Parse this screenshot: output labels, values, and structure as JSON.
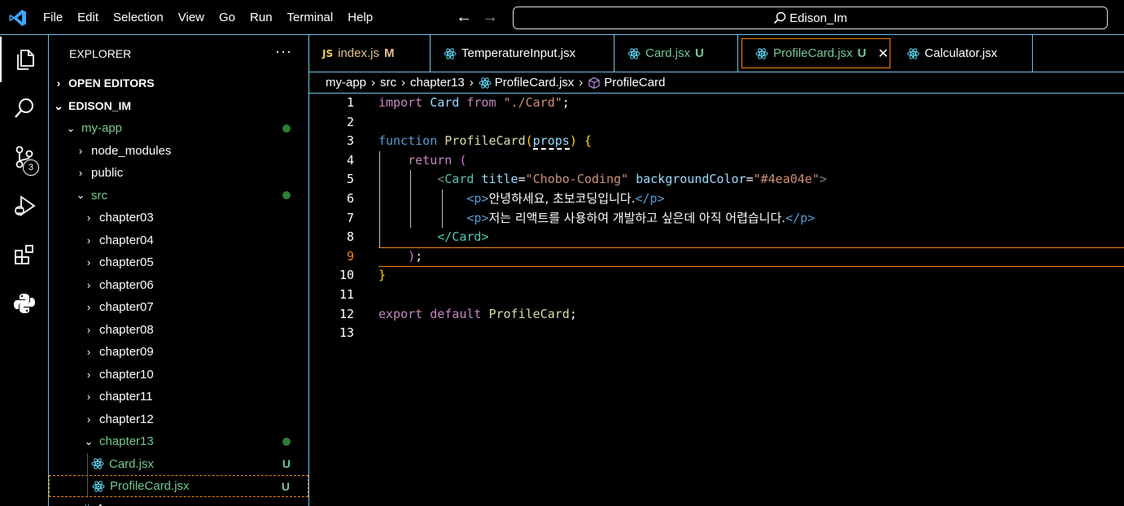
{
  "menu": [
    "File",
    "Edit",
    "Selection",
    "View",
    "Go",
    "Run",
    "Terminal",
    "Help"
  ],
  "search": {
    "text": "Edison_Im"
  },
  "activity": {
    "scm_badge": "3"
  },
  "sidebar": {
    "title": "EXPLORER",
    "more": "···",
    "open_editors": "OPEN EDITORS",
    "workspace": "EDISON_IM",
    "tree": [
      {
        "label": "my-app",
        "chevron": "⌄",
        "depth": 0,
        "green": true,
        "dot": true
      },
      {
        "label": "node_modules",
        "chevron": "›",
        "depth": 1
      },
      {
        "label": "public",
        "chevron": "›",
        "depth": 1
      },
      {
        "label": "src",
        "chevron": "⌄",
        "depth": 1,
        "green": true,
        "dot": true
      },
      {
        "label": "chapter03",
        "chevron": "›",
        "depth": 2
      },
      {
        "label": "chapter04",
        "chevron": "›",
        "depth": 2
      },
      {
        "label": "chapter05",
        "chevron": "›",
        "depth": 2
      },
      {
        "label": "chapter06",
        "chevron": "›",
        "depth": 2
      },
      {
        "label": "chapter07",
        "chevron": "›",
        "depth": 2
      },
      {
        "label": "chapter08",
        "chevron": "›",
        "depth": 2
      },
      {
        "label": "chapter09",
        "chevron": "›",
        "depth": 2
      },
      {
        "label": "chapter10",
        "chevron": "›",
        "depth": 2
      },
      {
        "label": "chapter11",
        "chevron": "›",
        "depth": 2
      },
      {
        "label": "chapter12",
        "chevron": "›",
        "depth": 2
      },
      {
        "label": "chapter13",
        "chevron": "⌄",
        "depth": 2,
        "green": true,
        "dot": true
      },
      {
        "label": "Card.jsx",
        "depth": 3,
        "green": true,
        "u": "U",
        "react": true
      },
      {
        "label": "ProfileCard.jsx",
        "depth": 3,
        "green": true,
        "u": "U",
        "react": true,
        "selected": true
      },
      {
        "label": "App.css",
        "depth": 2,
        "hash": true
      }
    ]
  },
  "tabs": [
    {
      "label": "index.js",
      "icon": "JS",
      "status": "M"
    },
    {
      "label": "TemperatureInput.jsx"
    },
    {
      "label": "Card.jsx",
      "status": "U",
      "green": true
    },
    {
      "label": "ProfileCard.jsx",
      "status": "U",
      "green": true,
      "active": true,
      "close": "✕"
    },
    {
      "label": "Calculator.jsx"
    }
  ],
  "breadcrumb": [
    "my-app",
    "src",
    "chapter13",
    "ProfileCard.jsx",
    "ProfileCard"
  ],
  "editor": {
    "line_numbers": [
      "1",
      "2",
      "3",
      "4",
      "5",
      "6",
      "7",
      "8",
      "9",
      "10",
      "11",
      "12",
      "13"
    ],
    "current_line": 9,
    "code": {
      "l1": {
        "kw": "import",
        "id": "Card",
        "kw2": "from",
        "str": "\"./Card\"",
        "end": ";"
      },
      "l3": {
        "kw": "function",
        "fn": "ProfileCard",
        "open": "(",
        "param": "props",
        "close": ")",
        "brace": "{"
      },
      "l4": {
        "kw": "return",
        "paren": "("
      },
      "l5": {
        "lt": "<",
        "tag": "Card",
        "attr1": "title",
        "eq1": "=",
        "val1": "\"Chobo-Coding\"",
        "attr2": "backgroundColor",
        "eq2": "=",
        "val2": "\"#4ea04e\"",
        "gt": ">"
      },
      "l6": {
        "open": "<p>",
        "text": "안녕하세요, 초보코딩입니다.",
        "close": "</p>"
      },
      "l7": {
        "open": "<p>",
        "text": "저는 리액트를 사용하여 개발하고 싶은데 아직 어렵습니다.",
        "close": "</p>"
      },
      "l8": {
        "close": "</Card>"
      },
      "l9": {
        "paren": ")",
        "end": ";"
      },
      "l10": {
        "brace": "}"
      },
      "l12": {
        "kw1": "export",
        "kw2": "default",
        "fn": "ProfileCard",
        "end": ";"
      }
    }
  }
}
